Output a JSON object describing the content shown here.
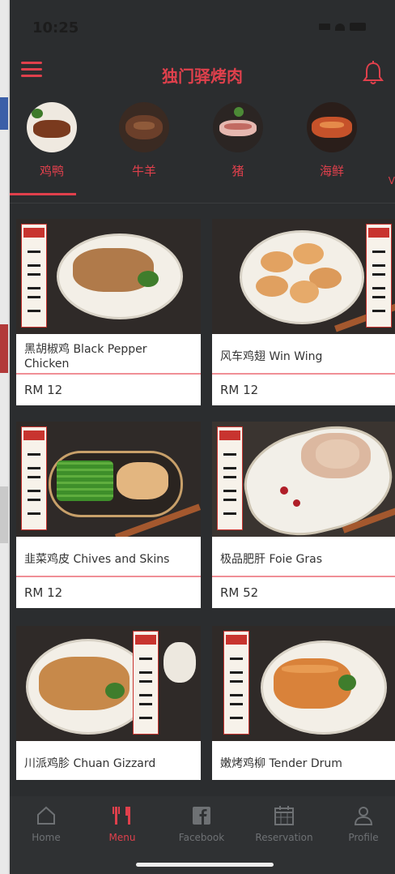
{
  "status": {
    "time": "10:25"
  },
  "header": {
    "title": "独门驿烤肉"
  },
  "categories": [
    {
      "label": "鸡鸭"
    },
    {
      "label": "牛羊"
    },
    {
      "label": "猪"
    },
    {
      "label": "海鲜"
    }
  ],
  "category_overflow": "V",
  "products": [
    {
      "name": "黑胡椒鸡 Black Pepper Chicken",
      "price": "RM 12"
    },
    {
      "name": "风车鸡翅 Win Wing",
      "price": "RM 12"
    },
    {
      "name": "韭菜鸡皮 Chives and Skins",
      "price": "RM 12"
    },
    {
      "name": "极品肥肝 Foie Gras",
      "price": "RM 52"
    },
    {
      "name": "川派鸡胗 Chuan Gizzard",
      "price": ""
    },
    {
      "name": "嫩烤鸡柳 Tender Drum",
      "price": ""
    }
  ],
  "tabbar": {
    "items": [
      {
        "label": "Home",
        "icon": "home-icon"
      },
      {
        "label": "Menu",
        "icon": "fork-knife-icon"
      },
      {
        "label": "Facebook",
        "icon": "facebook-icon"
      },
      {
        "label": "Reservation",
        "icon": "calendar-icon"
      },
      {
        "label": "Profile",
        "icon": "person-icon"
      }
    ],
    "active": "Menu"
  },
  "colors": {
    "accent": "#e0404c",
    "background": "#2b2d2f",
    "tab_inactive": "#6e7174"
  }
}
